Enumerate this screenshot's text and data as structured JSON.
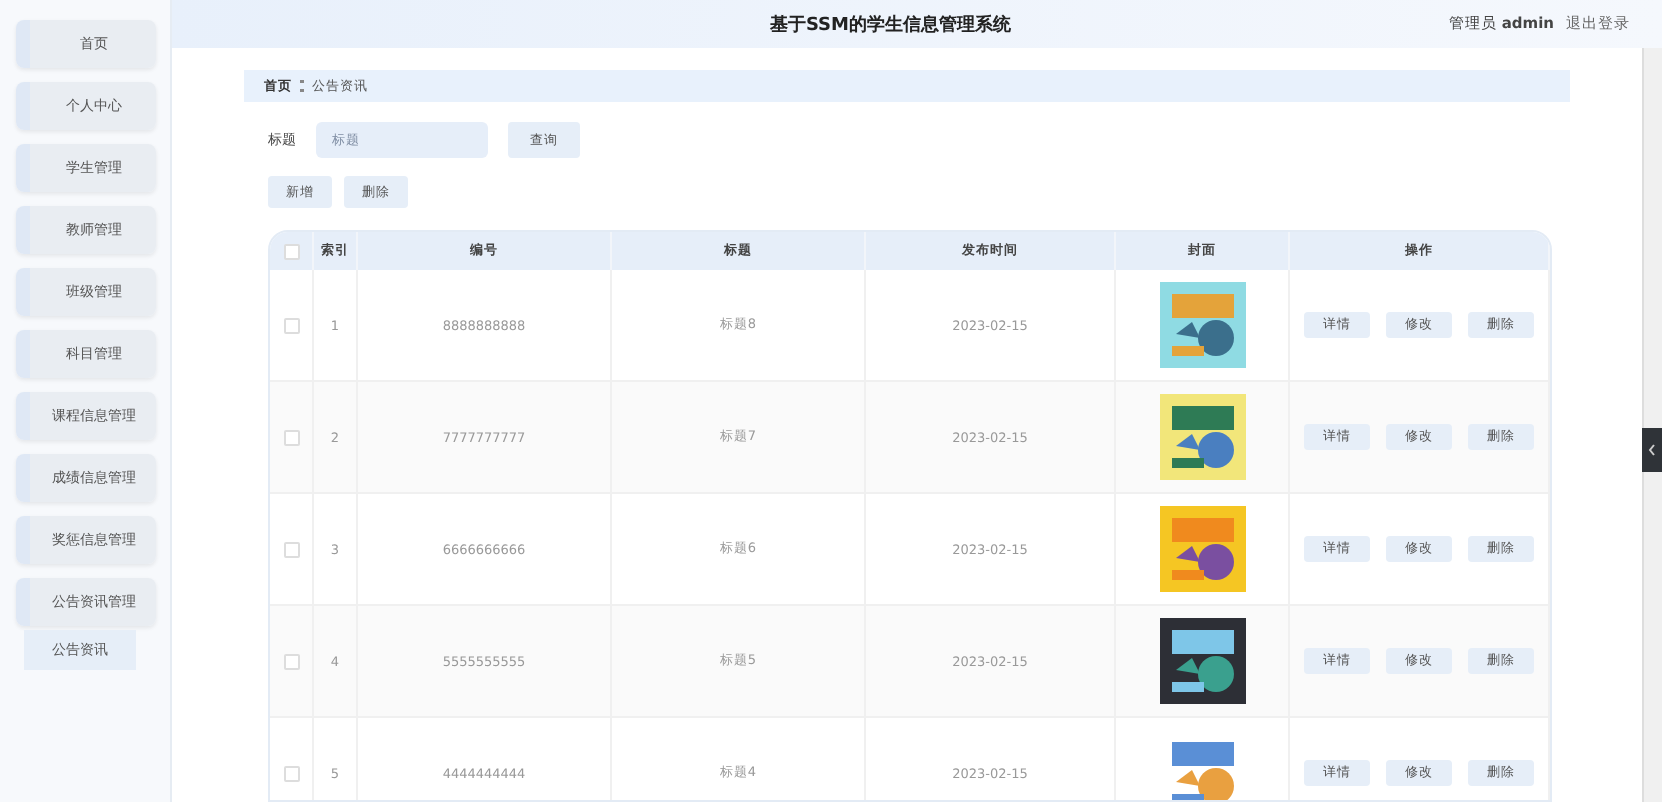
{
  "header": {
    "title": "基于SSM的学生信息管理系统",
    "user_role": "管理员",
    "user_name": "admin",
    "logout": "退出登录"
  },
  "sidebar": {
    "items": [
      {
        "label": "首页"
      },
      {
        "label": "个人中心"
      },
      {
        "label": "学生管理"
      },
      {
        "label": "教师管理"
      },
      {
        "label": "班级管理"
      },
      {
        "label": "科目管理"
      },
      {
        "label": "课程信息管理"
      },
      {
        "label": "成绩信息管理"
      },
      {
        "label": "奖惩信息管理"
      },
      {
        "label": "公告资讯管理",
        "children": [
          {
            "label": "公告资讯"
          }
        ]
      }
    ]
  },
  "breadcrumb": [
    "首页",
    "公告资讯"
  ],
  "search": {
    "label": "标题",
    "placeholder": "标题",
    "button": "查询"
  },
  "actions": [
    "新增",
    "删除"
  ],
  "table": {
    "all_checked": false,
    "columns": [
      "索引",
      "编号",
      "标题",
      "发布时间",
      "封面",
      "操作"
    ],
    "rows": [
      {
        "index": "1",
        "code": "8888888888",
        "title": "标题8",
        "date": "2023-02-15",
        "checked": false,
        "buttons": [
          "详情",
          "修改",
          "删除"
        ]
      },
      {
        "index": "2",
        "code": "7777777777",
        "title": "标题7",
        "date": "2023-02-15",
        "checked": false,
        "buttons": [
          "详情",
          "修改",
          "删除"
        ]
      },
      {
        "index": "3",
        "code": "6666666666",
        "title": "标题6",
        "date": "2023-02-15",
        "checked": false,
        "buttons": [
          "详情",
          "修改",
          "删除"
        ]
      },
      {
        "index": "4",
        "code": "5555555555",
        "title": "标题5",
        "date": "2023-02-15",
        "checked": false,
        "buttons": [
          "详情",
          "修改",
          "删除"
        ]
      },
      {
        "index": "5",
        "code": "4444444444",
        "title": "标题4",
        "date": "2023-02-15",
        "checked": false,
        "buttons": [
          "详情",
          "修改",
          "删除"
        ]
      }
    ]
  }
}
